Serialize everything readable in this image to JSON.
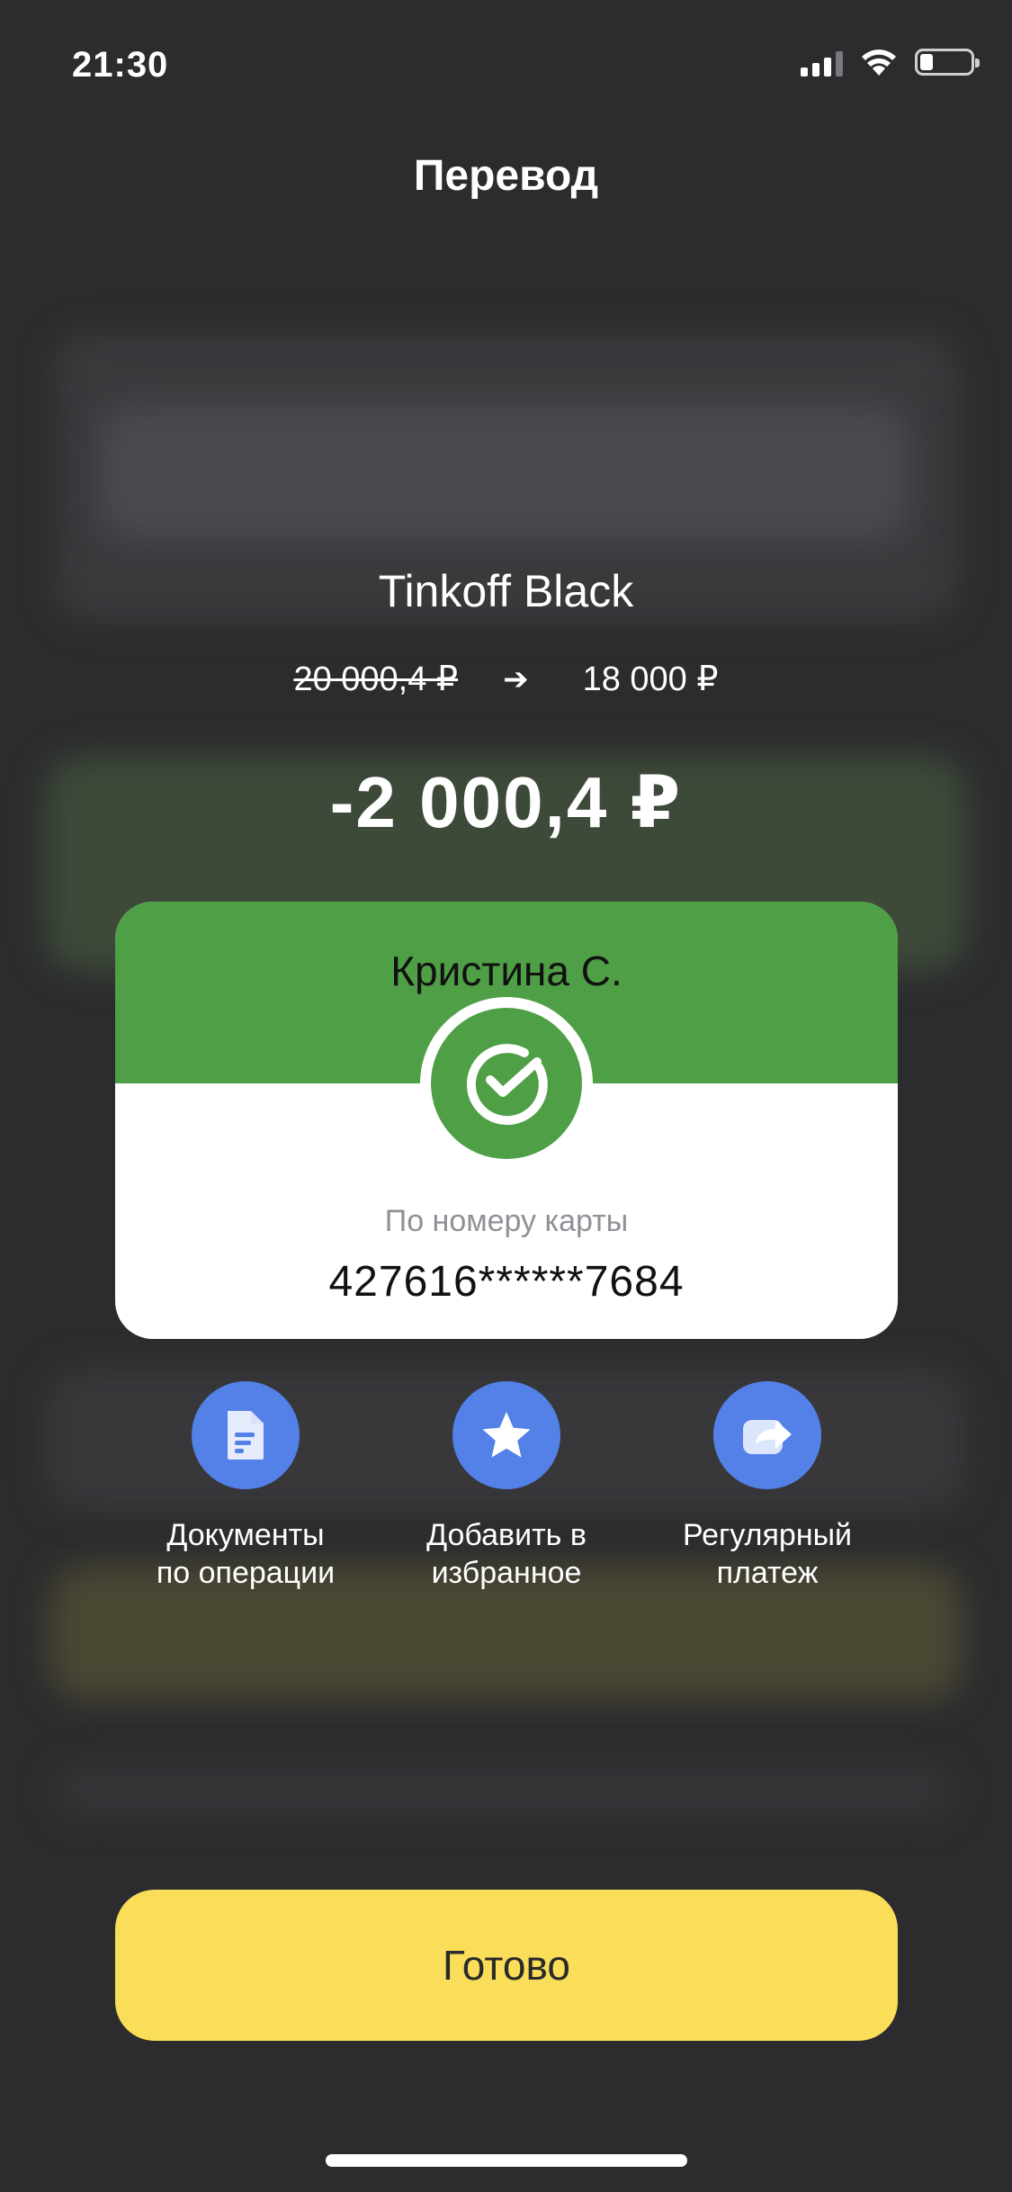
{
  "status_bar": {
    "time": "21:30",
    "battery_level": 0.15
  },
  "header": {
    "title": "Перевод"
  },
  "account": {
    "name": "Tinkoff Black",
    "balance_before": "20 000,4 ₽",
    "balance_after": "18 000 ₽"
  },
  "transfer": {
    "amount": "-2 000,4 ₽"
  },
  "recipient_card": {
    "name": "Кристина С.",
    "method": "По номеру карты",
    "card_number": "427616******7684",
    "bank_logo": "sberbank-check-icon",
    "brand_color": "#4e9f45"
  },
  "actions": [
    {
      "label": "Документы\nпо операции",
      "icon": "document-icon"
    },
    {
      "label": "Добавить в\nизбранное",
      "icon": "star-icon"
    },
    {
      "label": "Регулярный\nплатеж",
      "icon": "repeat-share-icon"
    }
  ],
  "done_button": {
    "label": "Готово",
    "color": "#fadd58"
  },
  "colors": {
    "accent_blue": "#5381e8",
    "background": "#2c2c2e"
  }
}
